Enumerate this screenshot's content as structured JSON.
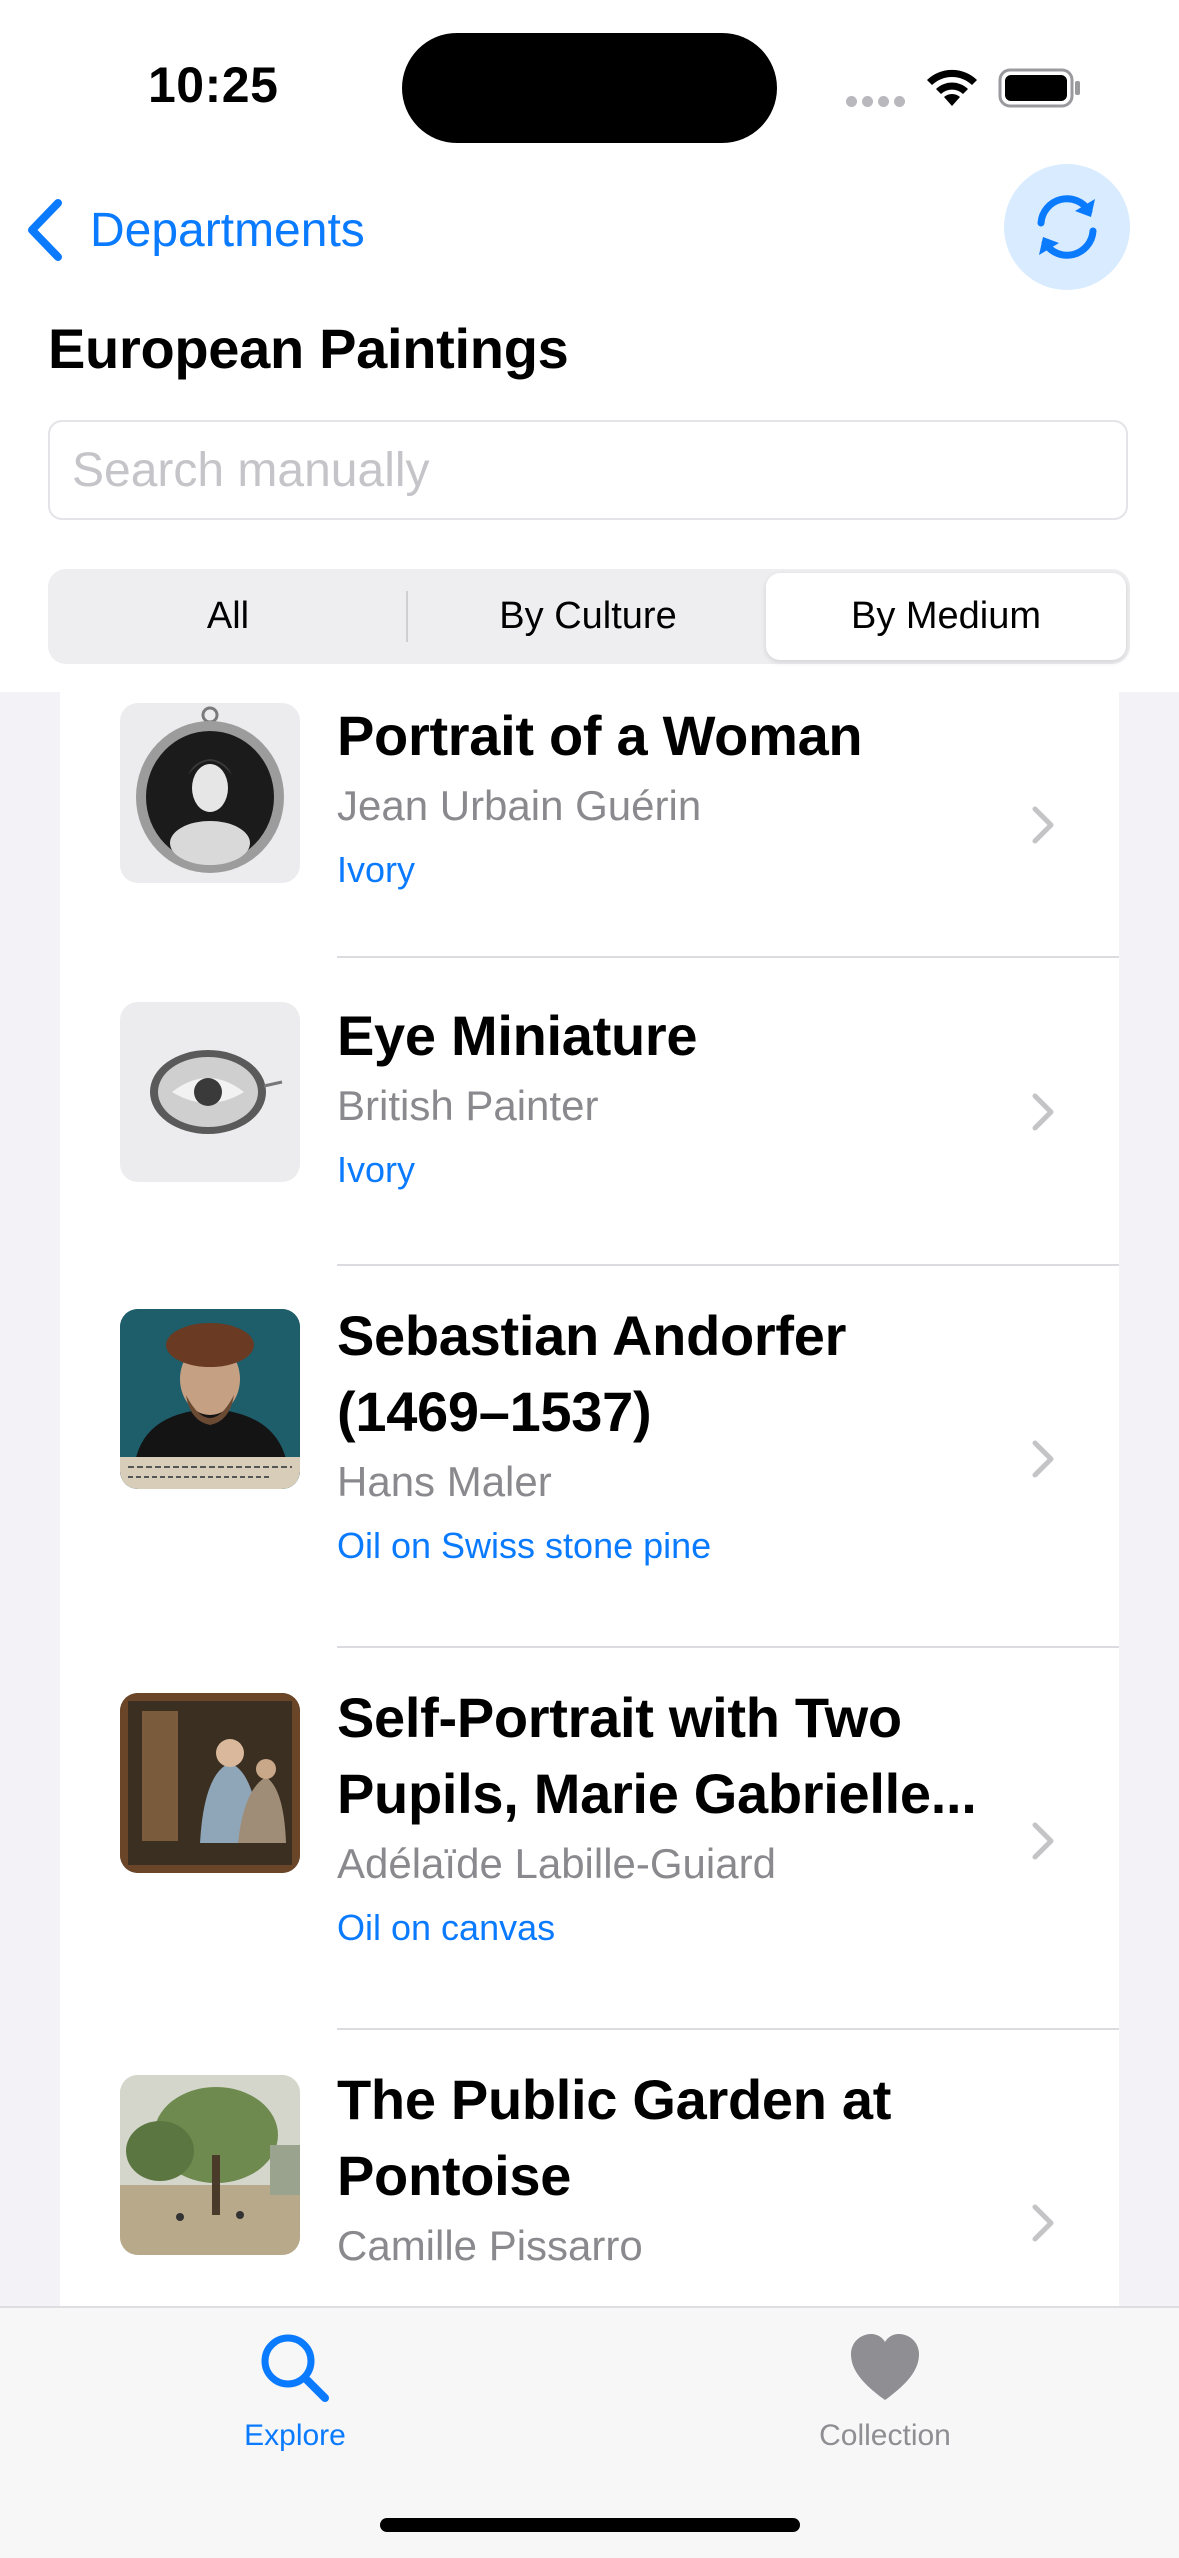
{
  "status_bar": {
    "time": "10:25"
  },
  "nav": {
    "back_label": "Departments"
  },
  "page": {
    "title": "European Paintings"
  },
  "search": {
    "placeholder": "Search manually",
    "value": ""
  },
  "segments": [
    {
      "label": "All",
      "selected": false
    },
    {
      "label": "By Culture",
      "selected": false
    },
    {
      "label": "By Medium",
      "selected": true
    }
  ],
  "artworks": [
    {
      "title": "Portrait of a Woman",
      "artist": "Jean Urbain Guérin",
      "medium": "Ivory"
    },
    {
      "title": "Eye Miniature",
      "artist": "British Painter",
      "medium": "Ivory"
    },
    {
      "title": "Sebastian Andorfer (1469–1537)",
      "artist": "Hans Maler",
      "medium": "Oil on Swiss stone pine"
    },
    {
      "title": "Self-Portrait with Two Pupils, Marie Gabrielle...",
      "artist": "Adélaïde Labille-Guiard",
      "medium": "Oil on canvas"
    },
    {
      "title": "The Public Garden at Pontoise",
      "artist": "Camille Pissarro",
      "medium": ""
    }
  ],
  "tabs": [
    {
      "label": "Explore",
      "icon": "magnifying-glass-icon",
      "selected": true
    },
    {
      "label": "Collection",
      "icon": "heart-icon",
      "selected": false
    }
  ],
  "colors": {
    "accent": "#0a7aff",
    "secondary_text": "#8a8a8e",
    "inactive_tab": "#8e8e93"
  }
}
